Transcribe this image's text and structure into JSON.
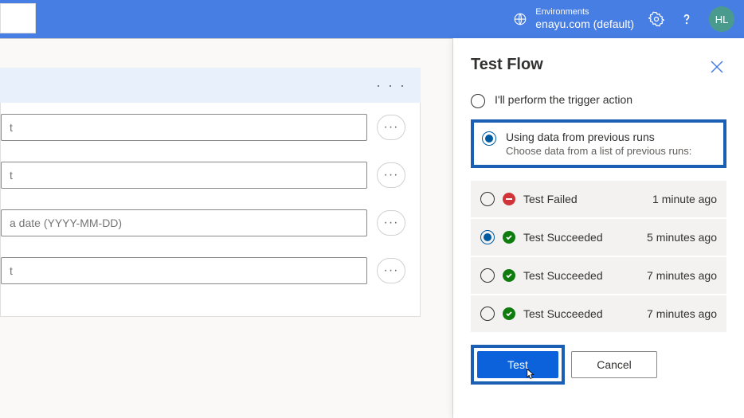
{
  "header": {
    "env_label": "Environments",
    "env_value": "enayu.com (default)",
    "avatar_initials": "HL"
  },
  "fields": [
    {
      "placeholder": "t"
    },
    {
      "placeholder": "t"
    },
    {
      "placeholder": "a date (YYYY-MM-DD)"
    },
    {
      "placeholder": "t"
    }
  ],
  "panel": {
    "title": "Test Flow",
    "option1": "I'll perform the trigger action",
    "option2_title": "Using data from previous runs",
    "option2_sub": "Choose data from a list of previous runs:",
    "runs": [
      {
        "status": "failed",
        "label": "Test Failed",
        "time": "1 minute ago",
        "selected": false
      },
      {
        "status": "succeeded",
        "label": "Test Succeeded",
        "time": "5 minutes ago",
        "selected": true
      },
      {
        "status": "succeeded",
        "label": "Test Succeeded",
        "time": "7 minutes ago",
        "selected": false
      },
      {
        "status": "succeeded",
        "label": "Test Succeeded",
        "time": "7 minutes ago",
        "selected": false
      }
    ],
    "test_btn": "Test",
    "cancel_btn": "Cancel"
  }
}
